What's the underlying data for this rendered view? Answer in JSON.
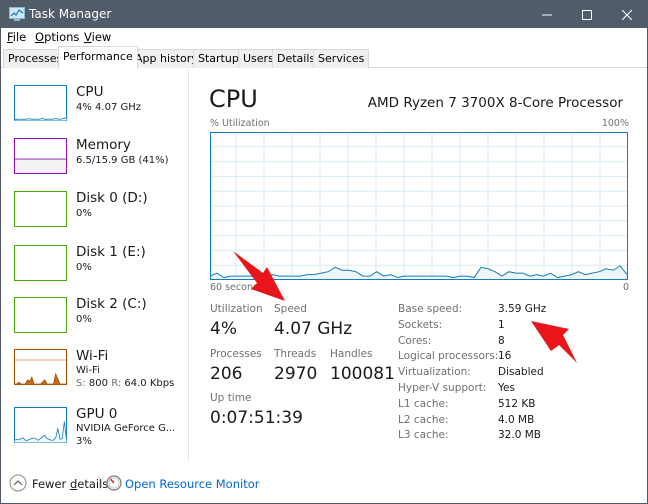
{
  "window": {
    "title": "Task Manager",
    "controls": {
      "minimize": "minimize-icon",
      "maximize": "maximize-icon",
      "close": "close-icon"
    }
  },
  "menu": [
    "File",
    "Options",
    "View"
  ],
  "tabs": [
    {
      "label": "Processes",
      "active": false
    },
    {
      "label": "Performance",
      "active": true
    },
    {
      "label": "App history",
      "active": false
    },
    {
      "label": "Startup",
      "active": false
    },
    {
      "label": "Users",
      "active": false
    },
    {
      "label": "Details",
      "active": false
    },
    {
      "label": "Services",
      "active": false
    }
  ],
  "sidebar": {
    "items": [
      {
        "name": "CPU",
        "sub": "4% 4.07 GHz",
        "color": "#117dbb"
      },
      {
        "name": "Memory",
        "sub": "6.5/15.9 GB (41%)",
        "color": "#8b12ae",
        "fill_fraction": 0.41
      },
      {
        "name": "Disk 0 (D:)",
        "sub": "0%",
        "color": "#4da60c"
      },
      {
        "name": "Disk 1 (E:)",
        "sub": "0%",
        "color": "#4da60c"
      },
      {
        "name": "Disk 2 (C:)",
        "sub": "0%",
        "color": "#4da60c"
      },
      {
        "name": "Wi-Fi",
        "sub": "Wi-Fi",
        "send_label": "S:",
        "send_value": "800",
        "recv_label": "R:",
        "recv_value": "64.0 Kbps",
        "color": "#a74f01"
      },
      {
        "name": "GPU 0",
        "sub": "NVIDIA GeForce G...",
        "sub2": "3%",
        "color": "#117dbb"
      }
    ]
  },
  "main": {
    "title": "CPU",
    "processor": "AMD Ryzen 7 3700X 8-Core Processor",
    "graph": {
      "ylabel": "% Utilization",
      "ymax_label": "100%",
      "xstart_label": "60 seconds",
      "xend_label": "0",
      "color": "#117dbb"
    },
    "stats": {
      "utilization": {
        "label": "Utilization",
        "value": "4%"
      },
      "speed": {
        "label": "Speed",
        "value": "4.07 GHz"
      },
      "processes": {
        "label": "Processes",
        "value": "206"
      },
      "threads": {
        "label": "Threads",
        "value": "2970"
      },
      "handles": {
        "label": "Handles",
        "value": "100081"
      },
      "uptime": {
        "label": "Up time",
        "value": "0:07:51:39"
      }
    },
    "details": [
      {
        "label": "Base speed:",
        "value": "3.59 GHz"
      },
      {
        "label": "Sockets:",
        "value": "1"
      },
      {
        "label": "Cores:",
        "value": "8"
      },
      {
        "label": "Logical processors:",
        "value": "16"
      },
      {
        "label": "Virtualization:",
        "value": "Disabled"
      },
      {
        "label": "Hyper-V support:",
        "value": "Yes"
      },
      {
        "label": "L1 cache:",
        "value": "512 KB"
      },
      {
        "label": "L2 cache:",
        "value": "4.0 MB"
      },
      {
        "label": "L3 cache:",
        "value": "32.0 MB"
      }
    ]
  },
  "footer": {
    "fewer_details": "Fewer details",
    "open_resource_monitor": "Open Resource Monitor"
  },
  "chart_data": {
    "type": "area",
    "title": "CPU % Utilization",
    "xlabel": "60 seconds",
    "ylabel": "% Utilization",
    "ylim": [
      0,
      100
    ],
    "xlim": [
      60,
      0
    ],
    "grid": true,
    "x": [
      60,
      59,
      58,
      57,
      56,
      55,
      54,
      53,
      52,
      51,
      50,
      49,
      48,
      47,
      46,
      45,
      44,
      43,
      42,
      41,
      40,
      39,
      38,
      37,
      36,
      35,
      34,
      33,
      32,
      31,
      30,
      29,
      28,
      27,
      26,
      25,
      24,
      23,
      22,
      21,
      20,
      19,
      18,
      17,
      16,
      15,
      14,
      13,
      12,
      11,
      10,
      9,
      8,
      7,
      6,
      5,
      4,
      3,
      2,
      1,
      0
    ],
    "values": [
      2,
      4,
      1,
      2,
      2,
      2,
      2,
      2,
      2,
      3,
      2,
      2,
      2,
      2,
      3,
      3,
      4,
      5,
      8,
      6,
      6,
      5,
      2,
      2,
      5,
      2,
      3,
      1,
      2,
      2,
      2,
      2,
      2,
      2,
      2,
      1,
      2,
      2,
      1,
      8,
      7,
      5,
      2,
      5,
      4,
      4,
      2,
      3,
      2,
      4,
      1,
      2,
      3,
      5,
      3,
      4,
      5,
      7,
      6,
      9,
      3
    ]
  },
  "sidebar_sparklines": {
    "cpu": [
      2,
      2,
      2,
      3,
      2,
      2,
      3,
      4,
      2,
      2,
      3,
      2,
      3,
      5,
      2,
      2,
      3,
      2,
      3,
      4,
      3,
      2,
      4,
      5,
      6
    ],
    "wifi": [
      0,
      0,
      5,
      0,
      0,
      0,
      12,
      8,
      20,
      0,
      0,
      0,
      0,
      6,
      12,
      0,
      0,
      0,
      0,
      30,
      15,
      0,
      0,
      0,
      0
    ],
    "gpu": [
      5,
      8,
      6,
      10,
      12,
      5,
      5,
      8,
      10,
      12,
      9,
      5,
      10,
      15,
      20,
      10,
      8,
      5,
      6,
      12,
      40,
      8,
      10,
      60,
      8
    ]
  }
}
